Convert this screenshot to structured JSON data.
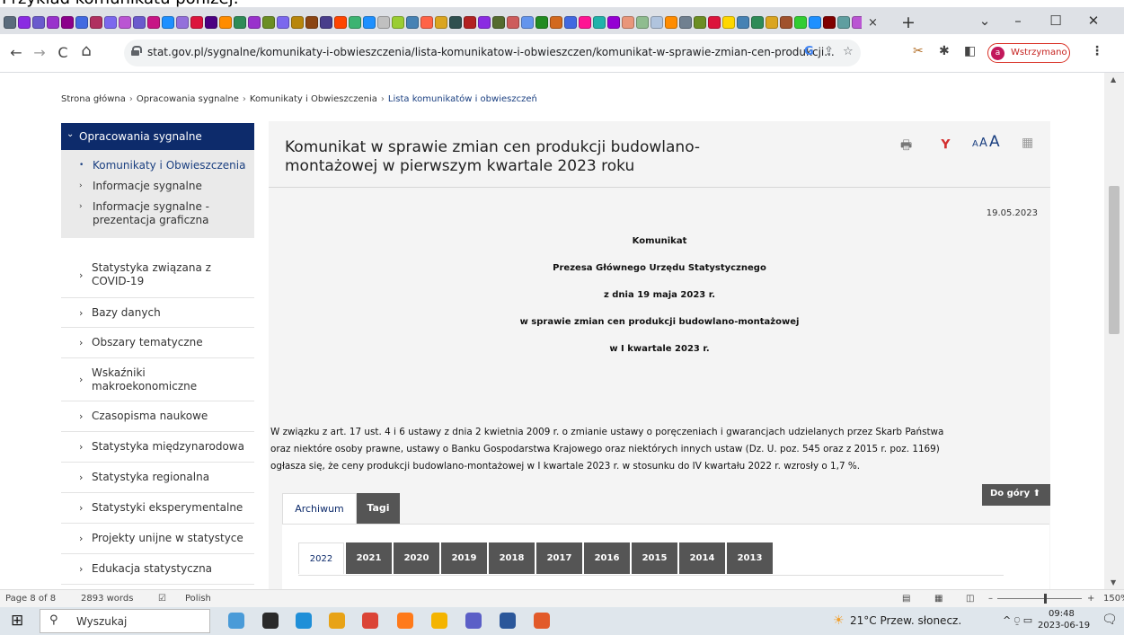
{
  "doc_caption": "Przykład komunikatu poniżej:",
  "browser": {
    "favicon_colors": [
      "#5a6b7c",
      "#8a2be2",
      "#6a5acd",
      "#9932cc",
      "#8b008b",
      "#4169e1",
      "#b03060",
      "#7b68ee",
      "#ba55d3",
      "#6a5acd",
      "#c71585",
      "#1e90ff",
      "#9370db",
      "#dc143c",
      "#4b0082",
      "#ff8c00",
      "#2e8b57",
      "#9932cc",
      "#6b8e23",
      "#7b68ee",
      "#b8860b",
      "#8b4513",
      "#483d8b",
      "#ff4500",
      "#3cb371",
      "#1e90ff",
      "#c0c0c0",
      "#9acd32",
      "#4682b4",
      "#ff6347",
      "#daa520",
      "#2f4f4f",
      "#b22222",
      "#8a2be2",
      "#556b2f",
      "#cd5c5c",
      "#6495ed",
      "#228b22",
      "#d2691e",
      "#4169e1",
      "#ff1493",
      "#20b2aa",
      "#9400d3",
      "#e9967a",
      "#8fbc8f",
      "#b0c4de",
      "#ff8c00",
      "#708090",
      "#6b8e23",
      "#dc143c",
      "#ffd700",
      "#4682b4",
      "#2e8b57",
      "#daa520",
      "#a0522d",
      "#32cd32",
      "#1e90ff",
      "#800000",
      "#5f9ea0",
      "#ba55d3",
      "#ff4500",
      "#00ced1",
      "#9acd32",
      "#708090",
      "#ffd700"
    ],
    "tab_close": "×",
    "new_tab": "+",
    "window_controls": {
      "dropdown": "⌄",
      "minimize": "–",
      "maximize": "☐",
      "close": "✕"
    },
    "nav": {
      "back": "←",
      "forward": "→",
      "reload": "C",
      "home": "⌂"
    },
    "url": "stat.gov.pl/sygnalne/komunikaty-i-obwieszczenia/lista-komunikatow-i-obwieszczen/komunikat-w-sprawie-zmian-cen-produkcji...",
    "url_icons": {
      "google": "G",
      "share": "⇪",
      "star": "☆"
    },
    "toolbar_icons": {
      "extension": "✂",
      "puzzle": "✱",
      "sidepanel": "◧",
      "menu": "⋮"
    },
    "profile": {
      "initial": "a",
      "label": "Wstrzymano"
    }
  },
  "breadcrumb": {
    "items": [
      "Strona główna",
      "Opracowania sygnalne",
      "Komunikaty i Obwieszczenia",
      "Lista komunikatów i obwieszczeń"
    ],
    "separator": "›"
  },
  "sidebar": {
    "active": "Opracowania sygnalne",
    "subitems": [
      "Komunikaty i Obwieszczenia",
      "Informacje sygnalne",
      "Informacje sygnalne - prezentacja graficzna"
    ],
    "items": [
      "Statystyka związana z COVID-19",
      "Bazy danych",
      "Obszary tematyczne",
      "Wskaźniki makroekonomiczne",
      "Czasopisma naukowe",
      "Statystyka międzynarodowa",
      "Statystyka regionalna",
      "Statystyki eksperymentalne",
      "Projekty unijne w statystyce",
      "Edukacja statystyczna"
    ]
  },
  "article": {
    "title": "Komunikat w sprawie zmian cen produkcji budowlano-montażowej w pierwszym kwartale 2023 roku",
    "tools": {
      "print": "🖶",
      "pdf": "⅄",
      "font_small": "A",
      "font_mid": "A",
      "font_large": "A",
      "qr": "▦"
    },
    "date": "19.05.2023",
    "heading_lines": [
      "Komunikat",
      "Prezesa Głównego Urzędu Statystycznego",
      "z dnia 19 maja 2023 r.",
      "w sprawie zmian cen produkcji budowlano-montażowej",
      "w I kwartale 2023 r."
    ],
    "body_lines": [
      "W związku z art. 17 ust. 4 i 6 ustawy z dnia 2 kwietnia 2009 r. o zmianie ustawy o poręczeniach i gwarancjach udzielanych przez Skarb Państwa",
      "oraz niektóre osoby prawne, ustawy o Banku Gospodarstwa Krajowego oraz niektórych innych ustaw (Dz. U. poz. 545 oraz z 2015 r. poz. 1169)",
      "ogłasza się, że ceny produkcji budowlano-montażowej w I kwartale 2023 r. w stosunku do IV kwartału 2022 r. wzrosły o 1,7 %."
    ],
    "back_to_top": "Do góry ⬆",
    "tabs": [
      "Archiwum",
      "Tagi"
    ],
    "years": [
      "2022",
      "2021",
      "2020",
      "2019",
      "2018",
      "2017",
      "2016",
      "2015",
      "2014",
      "2013"
    ]
  },
  "statusbar": {
    "page": "Page 8 of 8",
    "words": "2893 words",
    "proof_icon": "☑",
    "language": "Polish",
    "zoom": "150%",
    "zoom_minus": "–",
    "zoom_plus": "+"
  },
  "taskbar": {
    "start_icon": "⊞",
    "search_placeholder": "Wyszukaj",
    "search_glyph": "⚲",
    "app_colors": [
      "#4a9bd8",
      "#2a2a2a",
      "#1f8fd8",
      "#e8a317",
      "#db4437",
      "#ff7a1a",
      "#f4b400",
      "#5b5fc7",
      "#2b579a",
      "#e25a2a"
    ],
    "weather": "21°C  Przew. słonecz.",
    "tray_icons": "^ ⍜ ▭",
    "time": "09:48",
    "date": "2023-06-19",
    "notification": "🗨"
  }
}
